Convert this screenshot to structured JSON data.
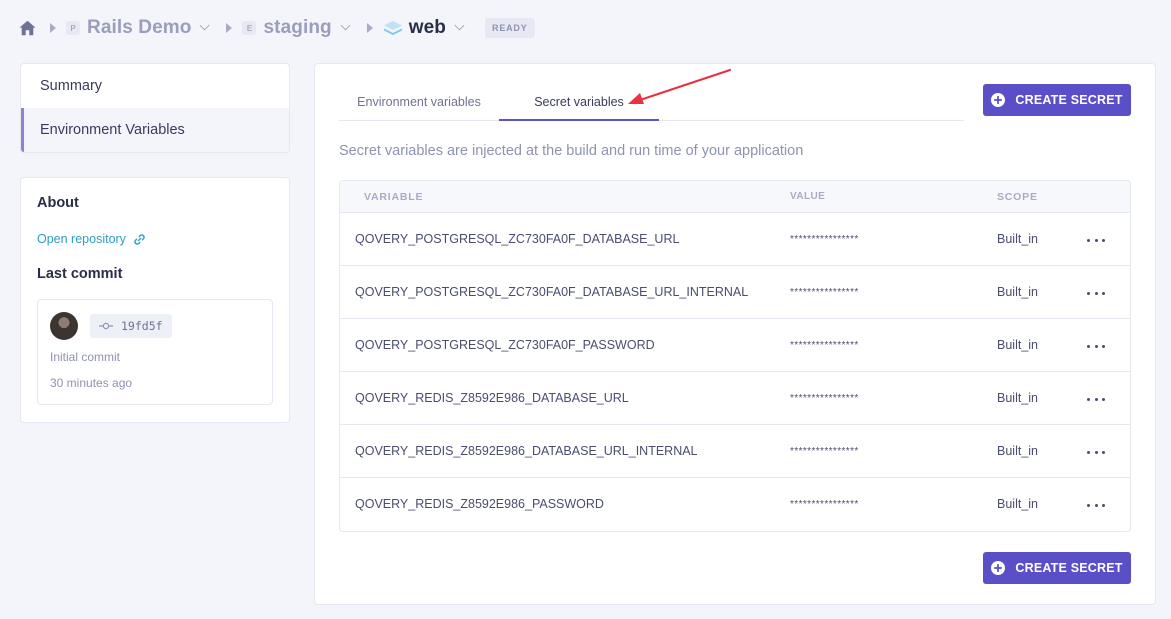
{
  "breadcrumb": {
    "project": {
      "badge": "P",
      "label": "Rails Demo"
    },
    "environment": {
      "badge": "E",
      "label": "staging"
    },
    "application": {
      "label": "web"
    },
    "status": "READY"
  },
  "sidebar": {
    "items": [
      {
        "label": "Summary"
      },
      {
        "label": "Environment Variables"
      }
    ]
  },
  "about": {
    "title": "About",
    "repo_link": "Open repository",
    "last_commit_title": "Last commit",
    "commit": {
      "sha": "19fd5f",
      "message": "Initial commit",
      "time": "30 minutes ago"
    }
  },
  "main": {
    "tabs": [
      {
        "label": "Environment variables"
      },
      {
        "label": "Secret variables"
      }
    ],
    "create_button": "CREATE SECRET",
    "description": "Secret variables are injected at the build and run time of your application",
    "table": {
      "headers": {
        "variable": "VARIABLE",
        "value": "VALUE",
        "scope": "SCOPE"
      },
      "rows": [
        {
          "variable": "QOVERY_POSTGRESQL_ZC730FA0F_DATABASE_URL",
          "value": "****************",
          "scope": "Built_in"
        },
        {
          "variable": "QOVERY_POSTGRESQL_ZC730FA0F_DATABASE_URL_INTERNAL",
          "value": "****************",
          "scope": "Built_in"
        },
        {
          "variable": "QOVERY_POSTGRESQL_ZC730FA0F_PASSWORD",
          "value": "****************",
          "scope": "Built_in"
        },
        {
          "variable": "QOVERY_REDIS_Z8592E986_DATABASE_URL",
          "value": "****************",
          "scope": "Built_in"
        },
        {
          "variable": "QOVERY_REDIS_Z8592E986_DATABASE_URL_INTERNAL",
          "value": "****************",
          "scope": "Built_in"
        },
        {
          "variable": "QOVERY_REDIS_Z8592E986_PASSWORD",
          "value": "****************",
          "scope": "Built_in"
        }
      ]
    }
  },
  "colors": {
    "accent": "#5b4fc8",
    "link": "#2f9dc7",
    "annotation_arrow": "#e8323f"
  },
  "icons": {
    "home": "home-icon",
    "web": "layers-icon",
    "link": "link-icon",
    "commit": "git-commit-icon",
    "create": "plus-circle-icon",
    "row_menu": "more-horizontal-icon"
  }
}
